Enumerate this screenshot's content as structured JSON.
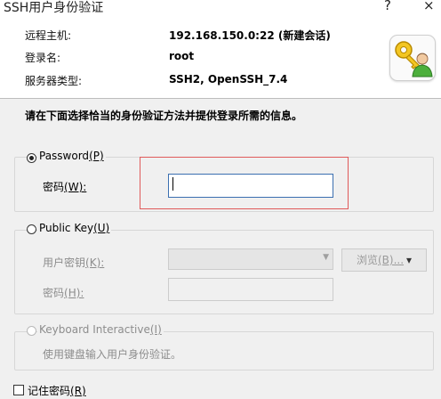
{
  "window": {
    "title": "SSH用户身份验证",
    "help_glyph": "?",
    "close_glyph": "×"
  },
  "info": {
    "host_label": "远程主机:",
    "host_value": "192.168.150.0:22 (新建会话)",
    "login_label": "登录名:",
    "login_value": "root",
    "server_label": "服务器类型:",
    "server_value": "SSH2, OpenSSH_7.4",
    "icon": "key-user-icon"
  },
  "instruction": "请在下面选择恰当的身份验证方法并提供登录所需的信息。",
  "password_group": {
    "radio_text": "Password",
    "radio_key": "(P)",
    "selected": true,
    "field_text": "密码",
    "field_key": "(W):",
    "value": ""
  },
  "publickey_group": {
    "radio_text": "Public Key",
    "radio_key": "(U)",
    "selected": false,
    "key_text": "用户密钥",
    "key_key": "(K):",
    "key_value": "",
    "browse_text": "浏览",
    "browse_key": "(B)...",
    "browse_arrow": "▾",
    "pass_text": "密码",
    "pass_key": "(H):"
  },
  "keyboard_group": {
    "radio_text": "Keyboard Interactive",
    "radio_key": "(I)",
    "selected": false,
    "description": "使用键盘输入用户身份验证。"
  },
  "remember": {
    "text": "记住密码",
    "key": "(R)",
    "checked": false
  },
  "colors": {
    "highlight_box": "#e05a5a",
    "focus_border": "#3b6fb0"
  }
}
